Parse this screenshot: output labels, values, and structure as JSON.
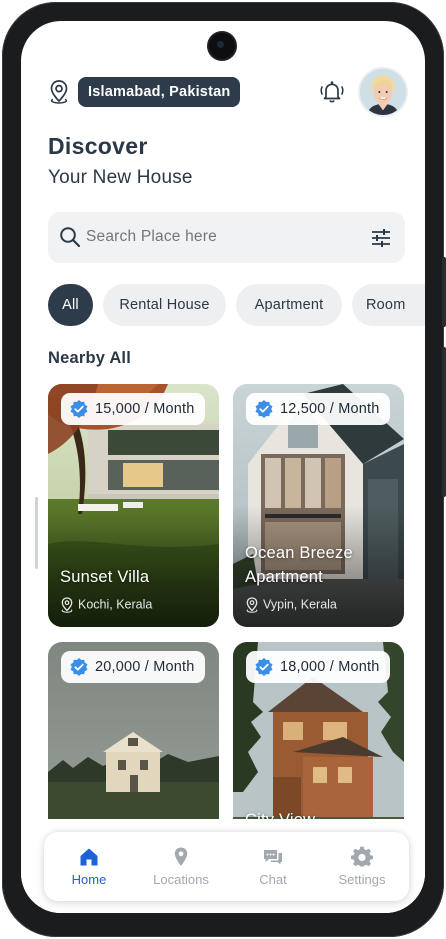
{
  "header": {
    "location_chip": "Islamabad, Pakistan",
    "icons": [
      "map-pin-icon",
      "bell-icon",
      "avatar"
    ]
  },
  "hero": {
    "title": "Discover",
    "subtitle": "Your New House"
  },
  "search": {
    "placeholder": "Search Place here",
    "value": ""
  },
  "categories": [
    {
      "label": "All",
      "active": true
    },
    {
      "label": "Rental House",
      "active": false
    },
    {
      "label": "Apartment",
      "active": false
    },
    {
      "label": "Room",
      "active": false
    }
  ],
  "section_title": "Nearby All",
  "listings": [
    {
      "price": "15,000 / Month",
      "name": "Sunset Villa",
      "location": "Kochi, Kerala"
    },
    {
      "price": "12,500 / Month",
      "name": "Ocean Breeze Apartment",
      "location": "Vypin, Kerala"
    },
    {
      "price": "20,000 / Month",
      "name": "",
      "location": ""
    },
    {
      "price": "18,000 / Month",
      "name": "City View",
      "location": ""
    }
  ],
  "nav": [
    {
      "label": "Home",
      "icon": "home-icon",
      "active": true
    },
    {
      "label": "Locations",
      "icon": "location-icon",
      "active": false
    },
    {
      "label": "Chat",
      "icon": "chat-icon",
      "active": false
    },
    {
      "label": "Settings",
      "icon": "settings-icon",
      "active": false
    }
  ],
  "colors": {
    "primary_dark": "#2d3b4a",
    "accent_blue": "#1b63d6",
    "verified_blue": "#3b8ee6",
    "chip_bg": "#eeeff1"
  }
}
